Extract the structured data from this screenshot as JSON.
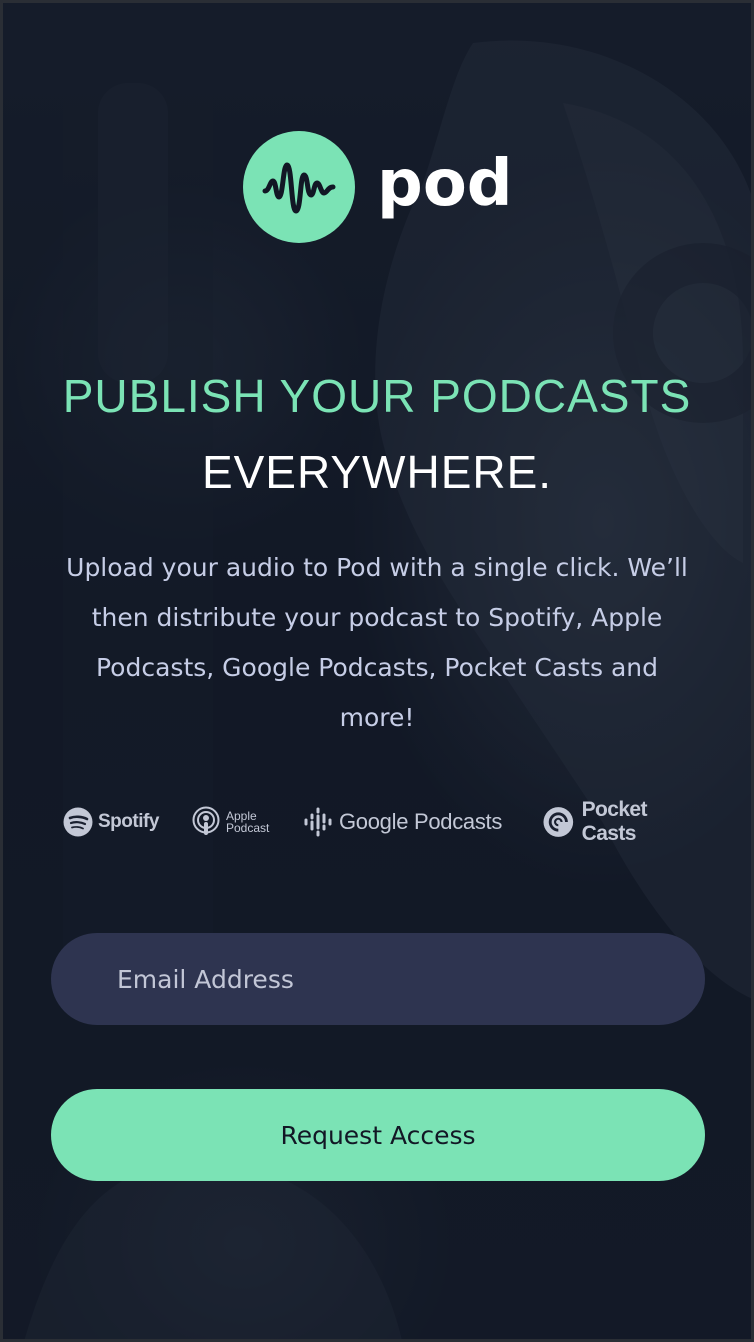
{
  "brand": {
    "name": "pod",
    "logo_icon": "waveform-icon",
    "accent_color": "#7be3b5"
  },
  "hero": {
    "headline_line1": "PUBLISH YOUR PODCASTS",
    "headline_line2": "EVERYWHERE.",
    "description": "Upload your audio to Pod with a single click. We’ll then distribute your podcast to Spotify, Apple Podcasts, Google Podcasts, Pocket Casts and more!"
  },
  "platforms": [
    {
      "name": "Spotify",
      "icon": "spotify-icon"
    },
    {
      "line1": "Apple",
      "line2": "Podcast",
      "icon": "apple-podcasts-icon"
    },
    {
      "name": "Google Podcasts",
      "icon": "google-podcasts-icon"
    },
    {
      "name": "Pocket Casts",
      "icon": "pocket-casts-icon"
    }
  ],
  "form": {
    "email_placeholder": "Email Address",
    "email_value": "",
    "submit_label": "Request Access"
  },
  "colors": {
    "background": "#121726",
    "input_background": "#2e3450",
    "text_muted": "#c6cde6",
    "button_text": "#121725"
  }
}
